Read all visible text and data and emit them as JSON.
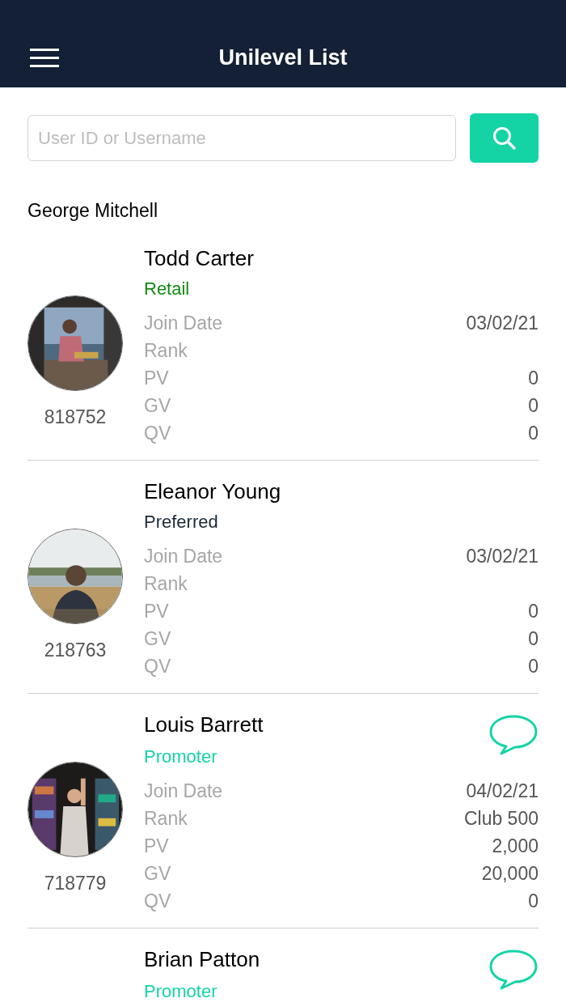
{
  "header": {
    "title": "Unilevel List"
  },
  "search": {
    "placeholder": "User ID or Username"
  },
  "sponsor": "George Mitchell",
  "members": [
    {
      "name": "Todd Carter",
      "type": "Retail",
      "color": "#138a13",
      "message": false,
      "id": "818752",
      "stats": [
        {
          "label": "Join Date",
          "value": "03/02/21"
        },
        {
          "label": "Rank"
        },
        {
          "label": "PV",
          "value": "0"
        },
        {
          "label": "GV",
          "value": "0"
        },
        {
          "label": "QV",
          "value": "0"
        }
      ]
    },
    {
      "name": "Eleanor Young",
      "type": "Preferred",
      "color": "#1c2a3a",
      "message": false,
      "id": "218763",
      "stats": [
        {
          "label": "Join Date",
          "value": "03/02/21"
        },
        {
          "label": "Rank"
        },
        {
          "label": "PV",
          "value": "0"
        },
        {
          "label": "GV",
          "value": "0"
        },
        {
          "label": "QV",
          "value": "0"
        }
      ]
    },
    {
      "name": "Louis Barrett",
      "type": "Promoter",
      "color": "#14d4a6",
      "message": true,
      "id": "718779",
      "stats": [
        {
          "label": "Join Date",
          "value": "04/02/21"
        },
        {
          "label": "Rank",
          "value": "Club 500"
        },
        {
          "label": "PV",
          "value": "2,000"
        },
        {
          "label": "GV",
          "value": "20,000"
        },
        {
          "label": "QV",
          "value": "0"
        }
      ]
    },
    {
      "name": "Brian Patton",
      "type": "Promoter",
      "color": "#14d4a6",
      "message": true
    }
  ]
}
